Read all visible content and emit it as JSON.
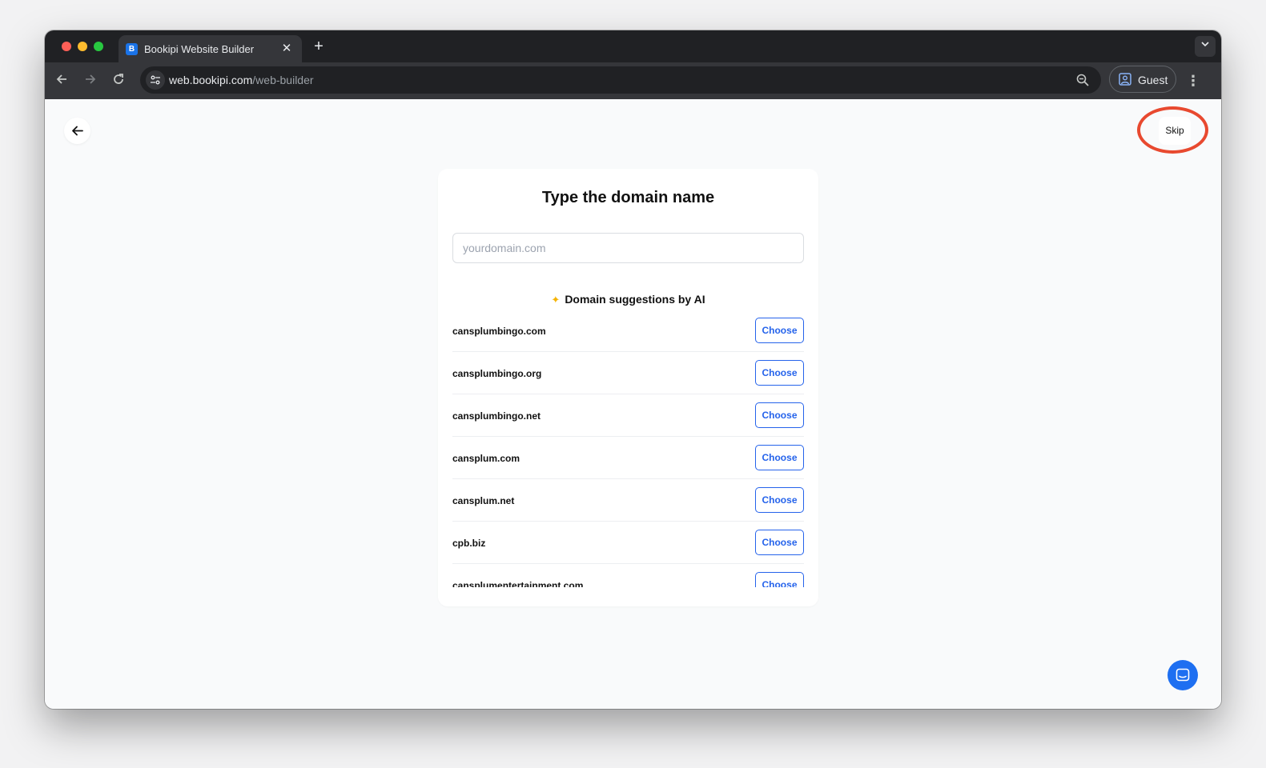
{
  "browser": {
    "tab_title": "Bookipi Website Builder",
    "tab_favicon": "B",
    "url_host": "web.bookipi.com",
    "url_path": "/web-builder",
    "profile_label": "Guest"
  },
  "page": {
    "skip_label": "Skip",
    "heading": "Type the domain name",
    "input_placeholder": "yourdomain.com",
    "input_value": "",
    "suggestions_title": "Domain suggestions by AI",
    "suggestions": [
      {
        "domain": "cansplumbingo.com",
        "action": "Choose"
      },
      {
        "domain": "cansplumbingo.org",
        "action": "Choose"
      },
      {
        "domain": "cansplumbingo.net",
        "action": "Choose"
      },
      {
        "domain": "cansplum.com",
        "action": "Choose"
      },
      {
        "domain": "cansplum.net",
        "action": "Choose"
      },
      {
        "domain": "cpb.biz",
        "action": "Choose"
      },
      {
        "domain": "cansplumentertainment.com",
        "action": "Choose"
      }
    ]
  },
  "colors": {
    "accent": "#2563eb",
    "highlight_ring": "#e8492f",
    "chat_button": "#1e6ff1",
    "sparkle": "#f5b301"
  },
  "icons": {
    "back": "arrow-left-icon",
    "chat": "chat-icon",
    "sparkle": "sparkle-icon"
  }
}
